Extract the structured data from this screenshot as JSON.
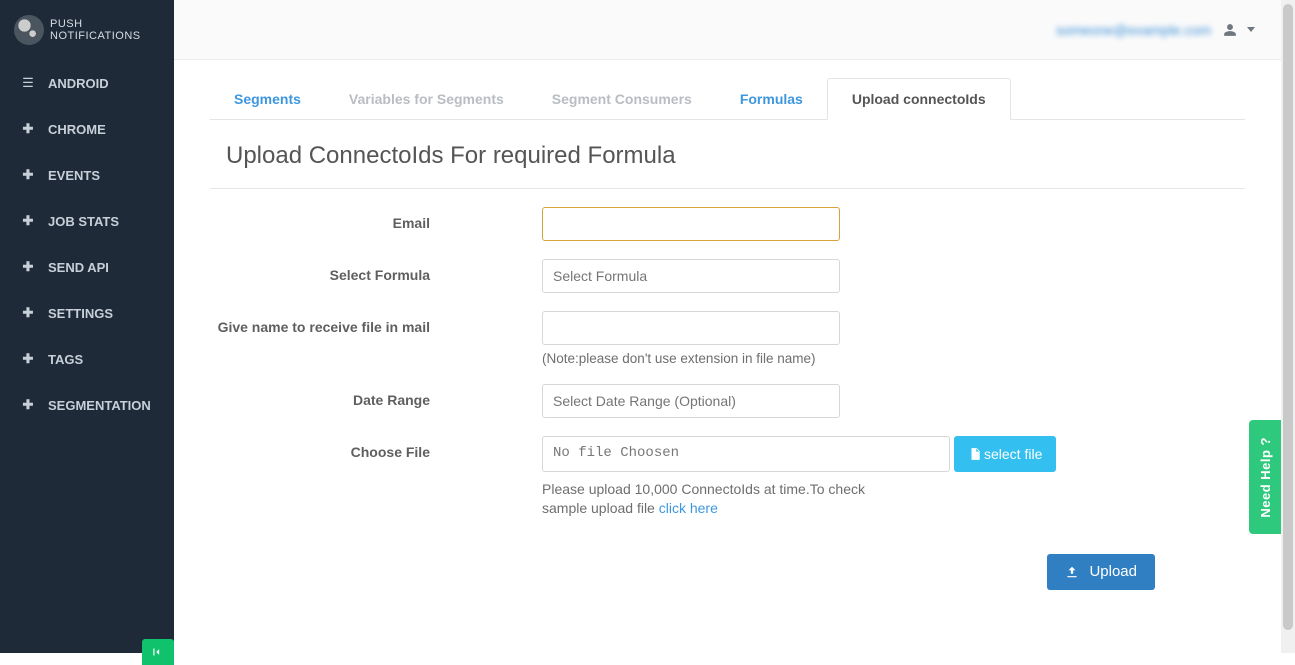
{
  "brand": {
    "title": "PUSH NOTIFICATIONS"
  },
  "sidebar": {
    "items": [
      {
        "label": "ANDROID",
        "icon": "list"
      },
      {
        "label": "CHROME",
        "icon": "plus"
      },
      {
        "label": "EVENTS",
        "icon": "plus"
      },
      {
        "label": "JOB STATS",
        "icon": "plus"
      },
      {
        "label": "SEND API",
        "icon": "plus"
      },
      {
        "label": "SETTINGS",
        "icon": "plus"
      },
      {
        "label": "TAGS",
        "icon": "plus"
      },
      {
        "label": "SEGMENTATION",
        "icon": "plus"
      }
    ]
  },
  "header": {
    "user_email": "someone@example.com"
  },
  "tabs": [
    {
      "label": "Segments",
      "active": false,
      "muted": false
    },
    {
      "label": "Variables for Segments",
      "active": false,
      "muted": true
    },
    {
      "label": "Segment Consumers",
      "active": false,
      "muted": true
    },
    {
      "label": "Formulas",
      "active": false,
      "muted": false
    },
    {
      "label": "Upload connectoIds",
      "active": true,
      "muted": false
    }
  ],
  "section": {
    "title": "Upload ConnectoIds For required Formula"
  },
  "form": {
    "email": {
      "label": "Email",
      "value": ""
    },
    "formula": {
      "label": "Select Formula",
      "placeholder": "Select Formula"
    },
    "filename": {
      "label": "Give name to receive file in mail",
      "value": "",
      "note": "(Note:please don't use extension in file name)"
    },
    "daterange": {
      "label": "Date Range",
      "placeholder": "Select Date Range (Optional)"
    },
    "choosefile": {
      "label": "Choose File",
      "value": "No file Choosen",
      "select_btn": "select file",
      "help_prefix": "Please upload 10,000 ConnectoIds at time.To check sample upload file ",
      "help_link": "click here"
    }
  },
  "buttons": {
    "upload": "Upload"
  },
  "help_tab": {
    "label": "Need Help ?"
  }
}
